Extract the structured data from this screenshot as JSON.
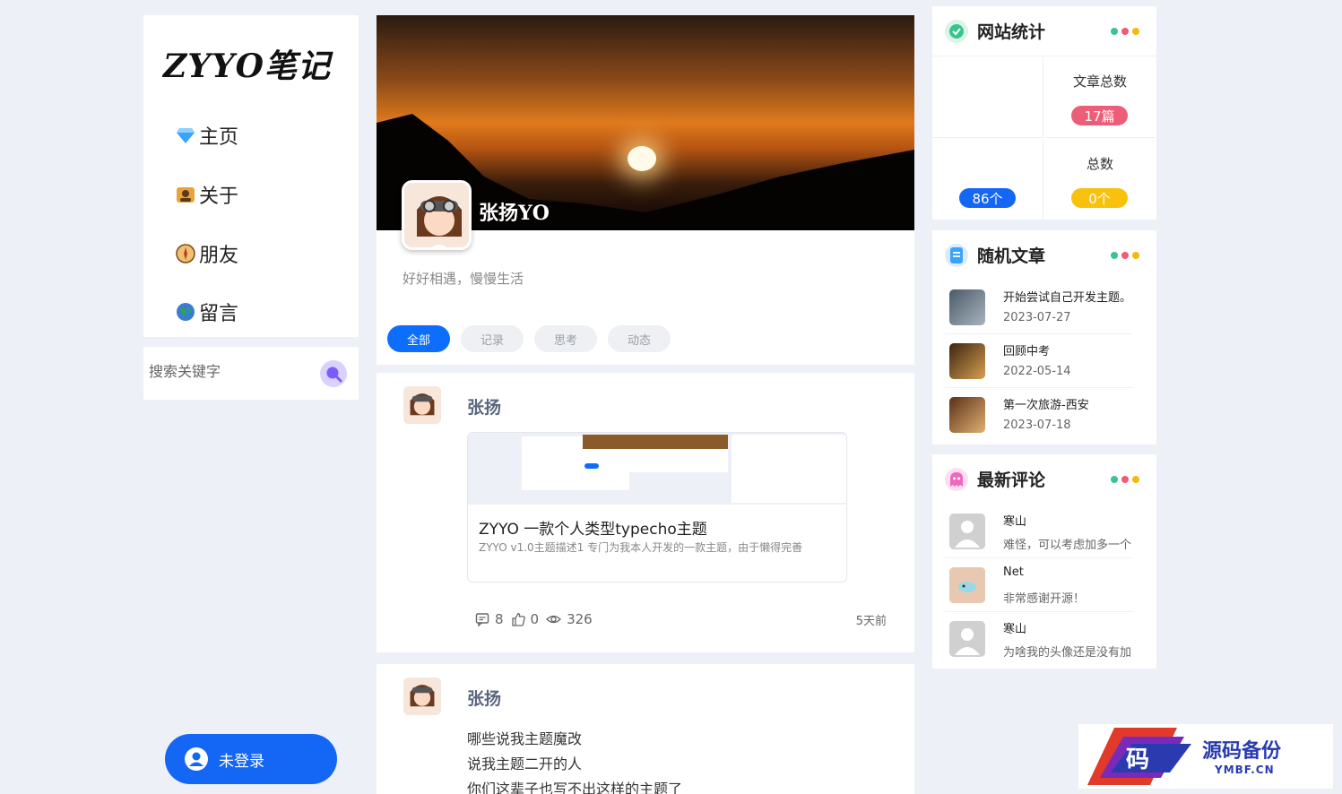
{
  "brand": {
    "logo_text": "ZYYO笔记"
  },
  "nav": {
    "items": [
      {
        "label": "主页",
        "icon": "gem-icon"
      },
      {
        "label": "关于",
        "icon": "profile-icon"
      },
      {
        "label": "朋友",
        "icon": "compass-icon"
      },
      {
        "label": "留言",
        "icon": "globe-icon"
      }
    ]
  },
  "search": {
    "placeholder": "搜索关键字"
  },
  "login": {
    "label": "未登录"
  },
  "profile": {
    "name": "张扬YO",
    "bio": "好好相遇，慢慢生活",
    "tabs": [
      "全部",
      "记录",
      "思考",
      "动态"
    ],
    "active_tab": "全部"
  },
  "posts": [
    {
      "author": "张扬",
      "link": {
        "title": "ZYYO 一款个人类型typecho主题",
        "desc": "ZYYO v1.0主题描述1 专门为我本人开发的一款主题，由于懒得完善"
      },
      "comments": "8",
      "likes": "0",
      "views": "326",
      "time": "5天前"
    },
    {
      "author": "张扬",
      "lines": [
        "哪些说我主题魔改",
        "说我主题二开的人",
        "你们这辈子也写不出这样的主题了"
      ]
    }
  ],
  "site_stats": {
    "title": "网站统计",
    "cells": [
      {
        "label": "",
        "value": "",
        "color": "#9aa0a8"
      },
      {
        "label": "文章总数",
        "value": "17篇",
        "color": "#ee5d76"
      },
      {
        "label": "",
        "value": "86个",
        "color": "#1466f4"
      },
      {
        "label": "总数",
        "value": "0个",
        "color": "#f8c10c"
      }
    ]
  },
  "random_posts": {
    "title": "随机文章",
    "items": [
      {
        "title": "开始尝试自己开发主题。",
        "date": "2023-07-27"
      },
      {
        "title": "回顾中考",
        "date": "2022-05-14"
      },
      {
        "title": "第一次旅游-西安",
        "date": "2023-07-18"
      }
    ]
  },
  "latest_comments": {
    "title": "最新评论",
    "items": [
      {
        "name": "寒山",
        "text": "难怪，可以考虑加多一个"
      },
      {
        "name": "Net",
        "text": "非常感谢开源！"
      },
      {
        "name": "寒山",
        "text": "为啥我的头像还是没有加"
      }
    ]
  },
  "watermark": {
    "title": "源码备份",
    "sub": "YMBF.CN",
    "glyph": "码"
  },
  "colors": {
    "accent": "#1466f4",
    "dot_green": "#3ac48d",
    "dot_red": "#ee5d76",
    "dot_yellow": "#f8b70c"
  }
}
